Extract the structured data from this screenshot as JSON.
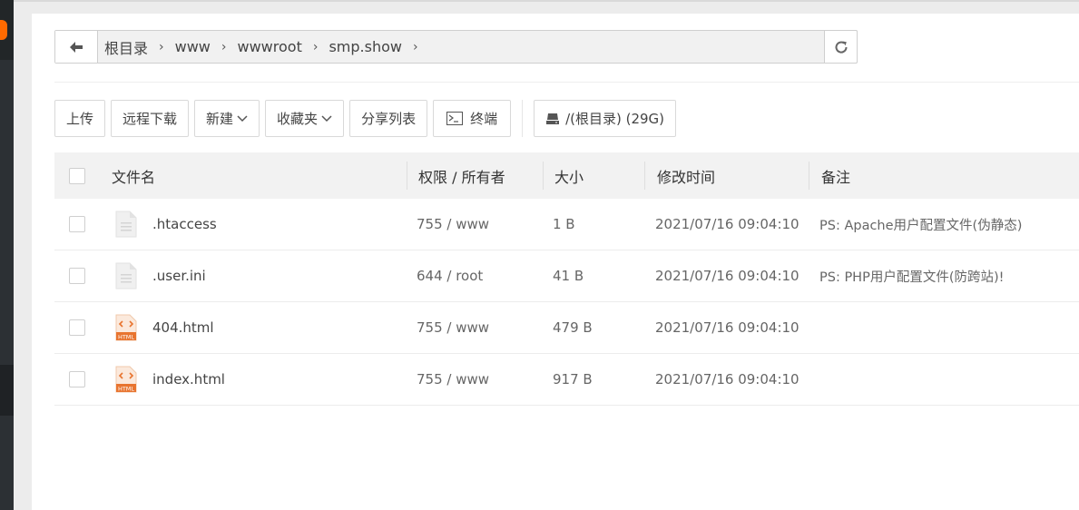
{
  "breadcrumb": {
    "items": [
      "根目录",
      "www",
      "wwwroot",
      "smp.show"
    ]
  },
  "toolbar": {
    "upload": "上传",
    "remote_download": "远程下载",
    "new": "新建",
    "favorites": "收藏夹",
    "share_list": "分享列表",
    "terminal": "终端",
    "disk": "/(根目录) (29G)"
  },
  "table": {
    "headers": {
      "name": "文件名",
      "perm": "权限 / 所有者",
      "size": "大小",
      "mtime": "修改时间",
      "remark": "备注"
    },
    "rows": [
      {
        "name": ".htaccess",
        "perm": "755 / www",
        "size": "1 B",
        "mtime": "2021/07/16 09:04:10",
        "remark": "PS: Apache用户配置文件(伪静态)",
        "icon": "text-file-icon"
      },
      {
        "name": ".user.ini",
        "perm": "644 / root",
        "size": "41 B",
        "mtime": "2021/07/16 09:04:10",
        "remark": "PS: PHP用户配置文件(防跨站)!",
        "icon": "text-file-icon"
      },
      {
        "name": "404.html",
        "perm": "755 / www",
        "size": "479 B",
        "mtime": "2021/07/16 09:04:10",
        "remark": "",
        "icon": "html-file-icon"
      },
      {
        "name": "index.html",
        "perm": "755 / www",
        "size": "917 B",
        "mtime": "2021/07/16 09:04:10",
        "remark": "",
        "icon": "html-file-icon"
      }
    ],
    "html_badge": "HTML"
  },
  "colors": {
    "html_icon": "#e8742f",
    "sidebar": "#2c3034",
    "accent": "#ff6a00"
  }
}
